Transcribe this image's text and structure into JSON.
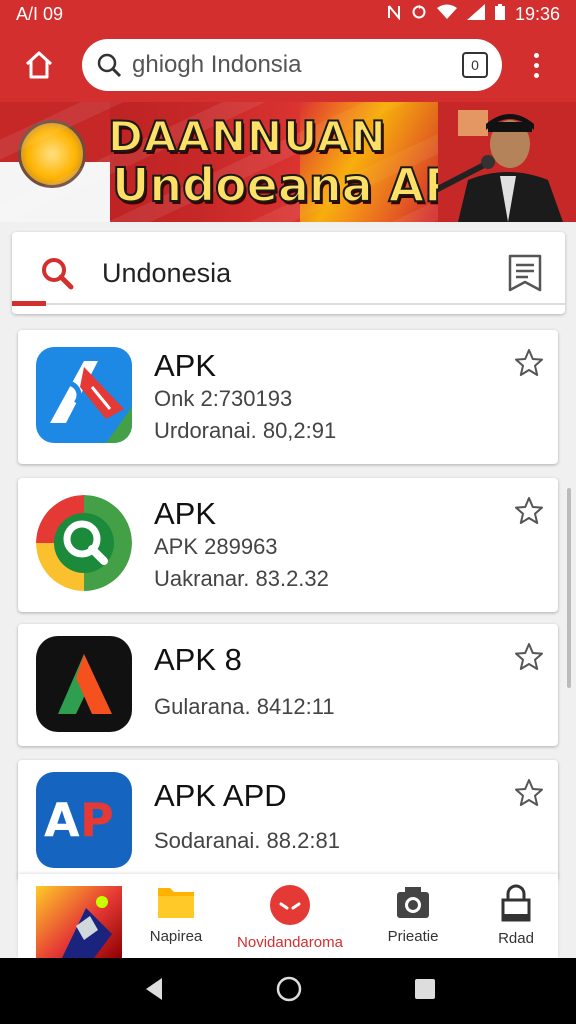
{
  "status_bar": {
    "left": "A/I 09",
    "icons": [
      "nfc-icon",
      "sync-icon",
      "wifi-icon",
      "signal-icon",
      "battery-icon"
    ],
    "time": "19:36"
  },
  "app_bar": {
    "url_text": "ghiogh Indonsia",
    "tab_count": "0"
  },
  "banner": {
    "line1": "DAANNUAN",
    "line2": "Undoeana APD!"
  },
  "search": {
    "query": "Undonesia"
  },
  "apps": [
    {
      "title": "APK",
      "line1": "Onk 2:730193",
      "line2": "Urdoranai. 80,2:91",
      "icon": "blue-red-chevron-icon"
    },
    {
      "title": "APK",
      "line1": "APK 289963",
      "line2": "Uakranar. 83.2.32",
      "icon": "google-style-g-icon"
    },
    {
      "title": "APK 8",
      "line1": "",
      "line2": "Gularana. 8412:11",
      "icon": "green-orange-a-icon"
    },
    {
      "title": "APK APD",
      "line1": "",
      "line2": "Sodaranai. 88.2:81",
      "icon": "ap-logo-icon"
    }
  ],
  "bottom_nav": {
    "items": [
      {
        "label": "Napirea",
        "icon": "folder-icon",
        "active": false
      },
      {
        "label": "Novidandaroma",
        "icon": "red-circle-icon",
        "active": true
      },
      {
        "label": "Prieatie",
        "icon": "camera-icon",
        "active": false
      },
      {
        "label": "Rdad",
        "icon": "lock-icon",
        "active": false
      }
    ]
  },
  "colors": {
    "accent": "#d32f2f",
    "background": "#f0f0f0"
  }
}
